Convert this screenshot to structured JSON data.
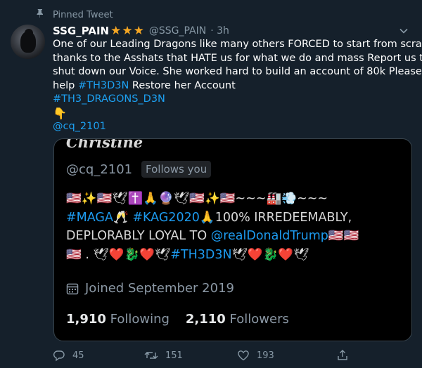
{
  "pinned": {
    "label": "Pinned Tweet",
    "icon": "pin-icon"
  },
  "tweet": {
    "author_name": "SSG_PAIN",
    "stars": "★★★",
    "handle": "@SSG_PAIN",
    "time": "· 3h",
    "lines": [
      "One of our Leading Dragons like many others FORCED to start from scratch",
      "thanks to the Asshats that HATE us for what we do and mass Report us to",
      "shut down our Voice.  She worked hard to build an account of 80k  Please"
    ],
    "line4_prefix": "help ",
    "hashtag1": "#TH3D3N",
    "line4_suffix": " Restore her Account",
    "hashtag2": "#TH3_DRAGONS_D3N",
    "pointing": "👇",
    "mention": "@cq_2101"
  },
  "card": {
    "name": "Christine",
    "handle": "@cq_2101",
    "follows_you": "Follows you",
    "bio_line1": "🇺🇸✨🇺🇸🕊✝️🙏🔮🕊🇺🇸✨🇺🇸~~~🏭💨~~~",
    "bio_line2_tag1": "#MAGA",
    "bio_line2_mid": "🥂 ",
    "bio_line2_tag2": "#KAG2020",
    "bio_line2_rest": "🙏100% IRREDEEMABLY,",
    "bio_line3_text": "DEPLORABLY LOYAL TO ",
    "bio_line3_mention": "@realDonaldTrump",
    "bio_line3_flags": "🇺🇸🇺🇸",
    "bio_line4_prefix": "🇺🇸 . 🕊❤️🐉❤️🕊",
    "bio_line4_tag": "#TH3D3N",
    "bio_line4_suffix": "🕊❤️🐉❤️🕊",
    "joined": "Joined September 2019",
    "following_count": "1,910",
    "following_label": "Following",
    "followers_count": "2,110",
    "followers_label": "Followers"
  },
  "actions": {
    "reply_count": "45",
    "retweet_count": "151",
    "like_count": "193"
  }
}
